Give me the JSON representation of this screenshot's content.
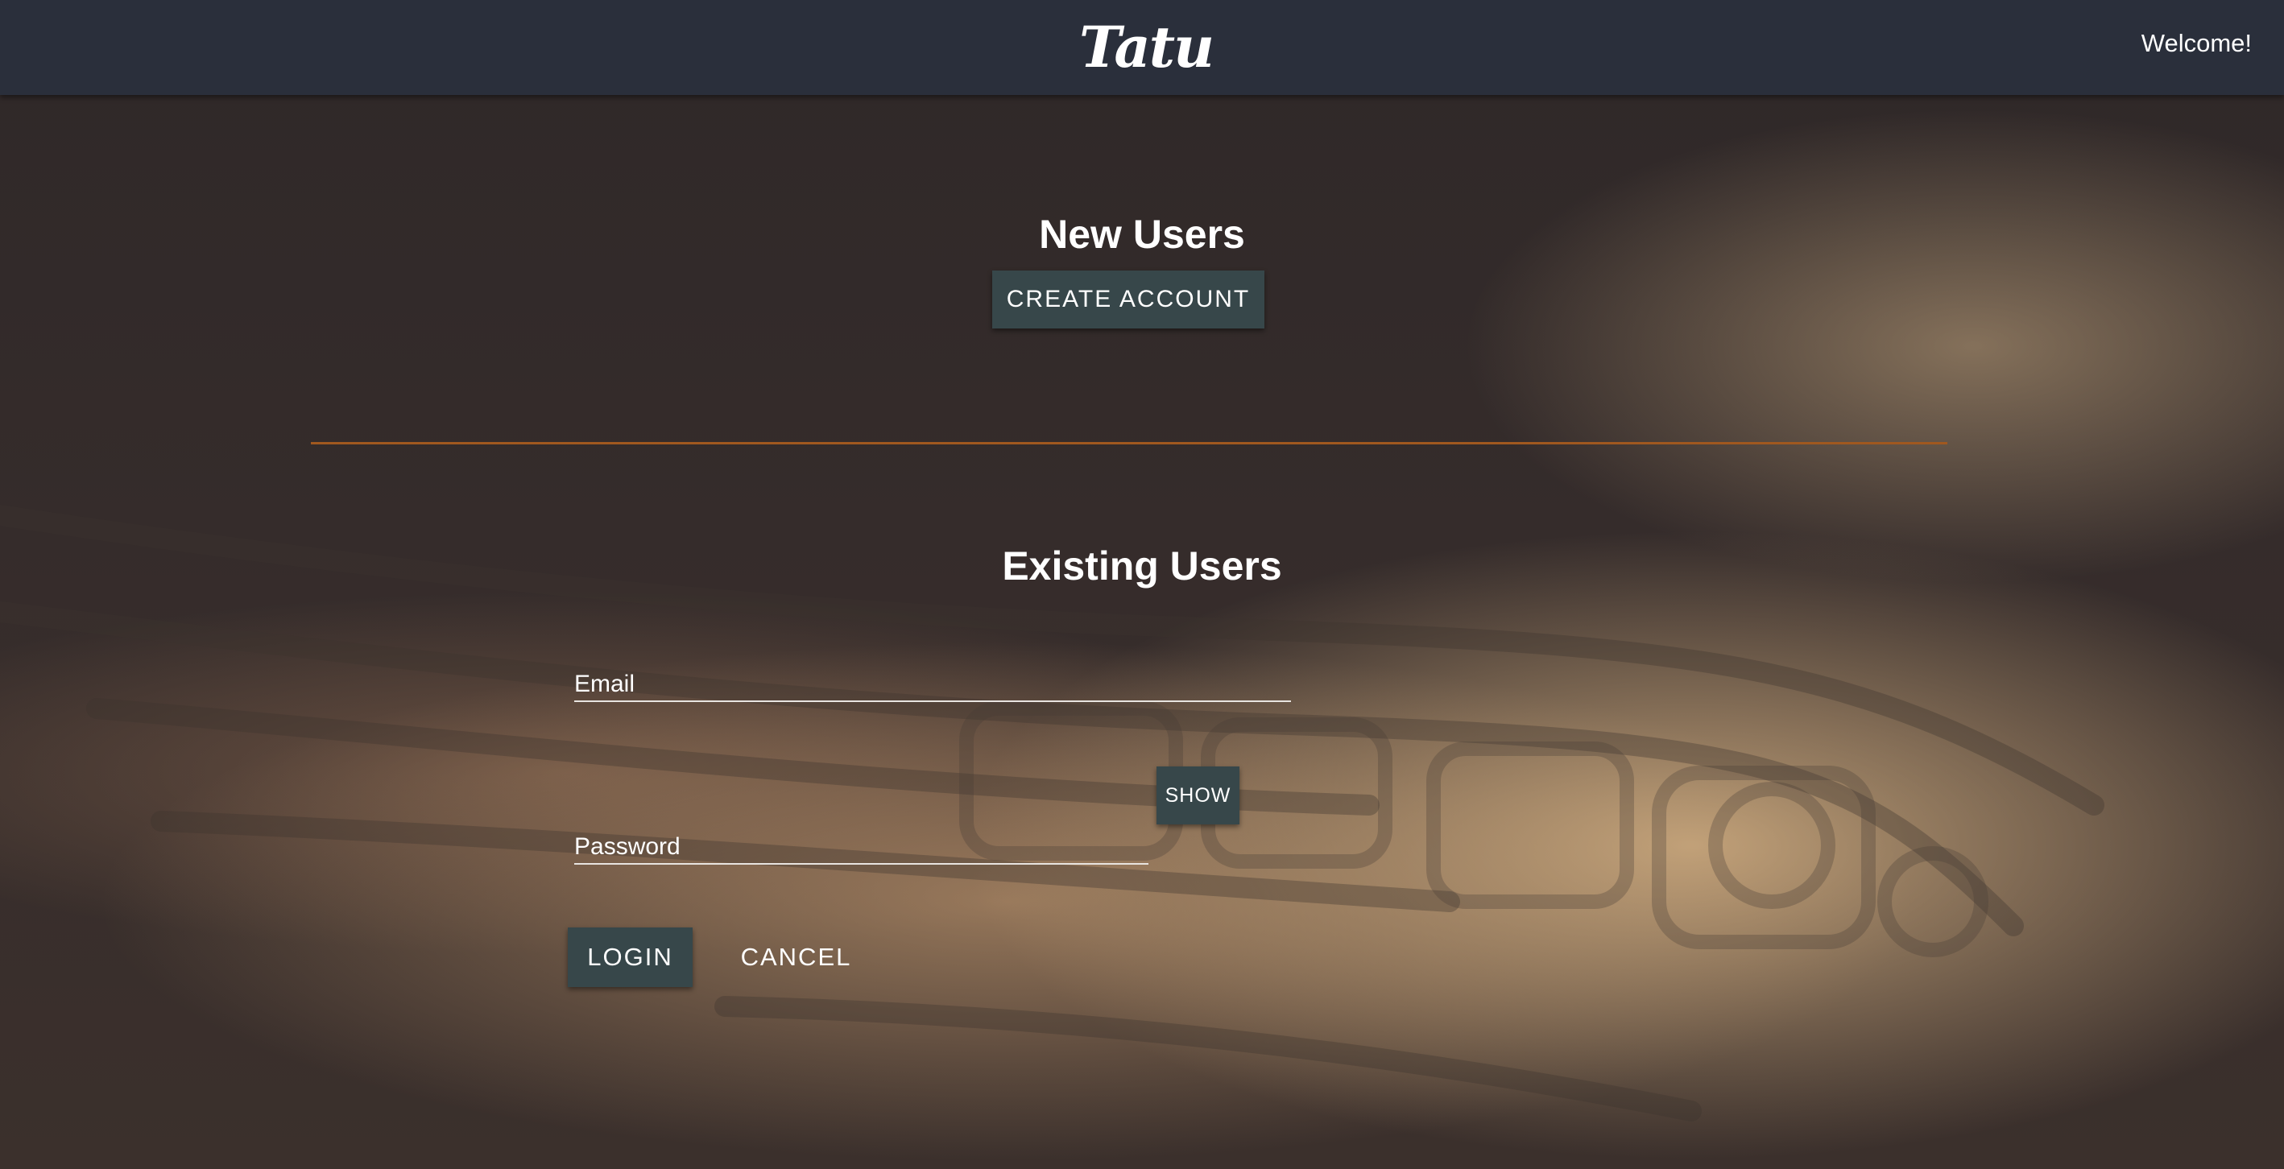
{
  "header": {
    "logo": "Tatu",
    "welcome": "Welcome!"
  },
  "new_users": {
    "heading": "New Users",
    "create_account_label": "CREATE ACCOUNT"
  },
  "existing_users": {
    "heading": "Existing Users",
    "email_label": "Email",
    "password_label": "Password",
    "show_label": "SHOW",
    "login_label": "LOGIN",
    "cancel_label": "CANCEL"
  },
  "colors": {
    "header_bg": "#2a2f3b",
    "button_bg": "#37474a",
    "divider": "#a0581f"
  }
}
